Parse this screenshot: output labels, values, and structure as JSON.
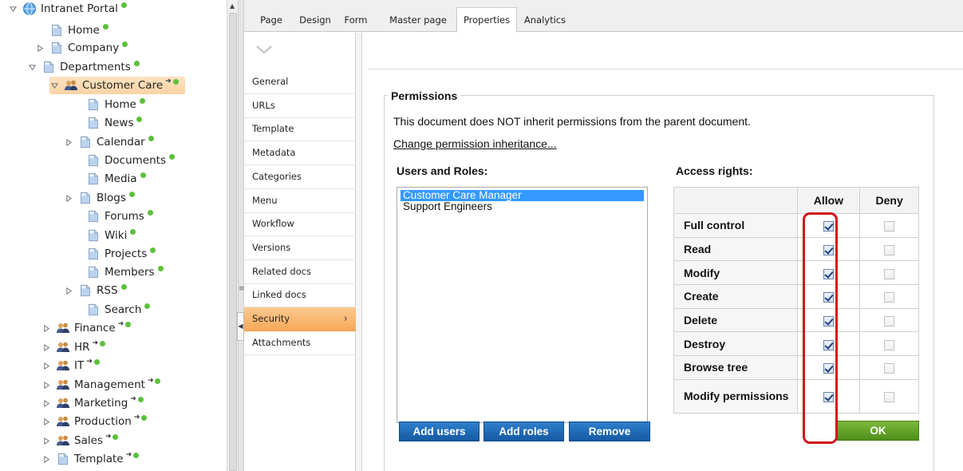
{
  "tree": {
    "items": [
      {
        "label": "Intranet Portal",
        "icon": "globe-icon",
        "expander": "down",
        "dot": true,
        "arrow": false
      },
      {
        "label": "Home",
        "icon": "page-icon",
        "expander": "none",
        "dot": true,
        "arrow": false
      },
      {
        "label": "Company",
        "icon": "page-icon",
        "expander": "right",
        "dot": true,
        "arrow": false
      },
      {
        "label": "Departments",
        "icon": "page-icon",
        "expander": "down",
        "dot": true,
        "arrow": false
      },
      {
        "label": "Customer Care",
        "icon": "users-icon",
        "expander": "down",
        "dot": true,
        "arrow": true,
        "selected": true
      },
      {
        "label": "Home",
        "icon": "page-icon",
        "expander": "none",
        "dot": true,
        "arrow": false
      },
      {
        "label": "News",
        "icon": "page-icon",
        "expander": "none",
        "dot": true,
        "arrow": false
      },
      {
        "label": "Calendar",
        "icon": "page-icon",
        "expander": "right",
        "dot": true,
        "arrow": false
      },
      {
        "label": "Documents",
        "icon": "page-icon",
        "expander": "none",
        "dot": true,
        "arrow": false
      },
      {
        "label": "Media",
        "icon": "page-icon",
        "expander": "none",
        "dot": true,
        "arrow": false
      },
      {
        "label": "Blogs",
        "icon": "page-icon",
        "expander": "right",
        "dot": true,
        "arrow": false
      },
      {
        "label": "Forums",
        "icon": "page-icon",
        "expander": "none",
        "dot": true,
        "arrow": false
      },
      {
        "label": "Wiki",
        "icon": "page-icon",
        "expander": "none",
        "dot": true,
        "arrow": false
      },
      {
        "label": "Projects",
        "icon": "page-icon",
        "expander": "none",
        "dot": true,
        "arrow": false
      },
      {
        "label": "Members",
        "icon": "page-icon",
        "expander": "none",
        "dot": true,
        "arrow": false
      },
      {
        "label": "RSS",
        "icon": "page-icon",
        "expander": "right",
        "dot": true,
        "arrow": false
      },
      {
        "label": "Search",
        "icon": "page-icon",
        "expander": "none",
        "dot": true,
        "arrow": false
      },
      {
        "label": "Finance",
        "icon": "users-icon",
        "expander": "right",
        "dot": true,
        "arrow": true
      },
      {
        "label": "HR",
        "icon": "users-icon",
        "expander": "right",
        "dot": true,
        "arrow": true
      },
      {
        "label": "IT",
        "icon": "users-icon",
        "expander": "right",
        "dot": true,
        "arrow": true
      },
      {
        "label": "Management",
        "icon": "users-icon",
        "expander": "right",
        "dot": true,
        "arrow": true
      },
      {
        "label": "Marketing",
        "icon": "users-icon",
        "expander": "right",
        "dot": true,
        "arrow": true
      },
      {
        "label": "Production",
        "icon": "users-icon",
        "expander": "right",
        "dot": true,
        "arrow": true
      },
      {
        "label": "Sales",
        "icon": "users-icon",
        "expander": "right",
        "dot": true,
        "arrow": true
      },
      {
        "label": "Template",
        "icon": "page-icon",
        "expander": "right",
        "dot": true,
        "arrow": true
      }
    ]
  },
  "tabs": [
    "Page",
    "Design",
    "Form",
    "Master page",
    "Properties",
    "Analytics"
  ],
  "active_tab": "Properties",
  "vmenu": {
    "items": [
      "General",
      "URLs",
      "Template",
      "Metadata",
      "Categories",
      "Menu",
      "Workflow",
      "Versions",
      "Related docs",
      "Linked docs",
      "Security",
      "Attachments"
    ],
    "active": "Security"
  },
  "permissions": {
    "legend": "Permissions",
    "inherit_text": "This document does NOT inherit permissions from the parent document.",
    "change_link": "Change permission inheritance...",
    "users_roles_label": "Users and Roles:",
    "access_rights_label": "Access rights:",
    "roles": [
      {
        "name": "Customer Care Manager",
        "selected": true
      },
      {
        "name": "Support Engineers",
        "selected": false
      }
    ],
    "buttons": {
      "add_users": "Add users",
      "add_roles": "Add roles",
      "remove": "Remove",
      "ok": "OK"
    },
    "columns": {
      "allow": "Allow",
      "deny": "Deny"
    },
    "rights": [
      {
        "name": "Full control",
        "allow": true,
        "deny": false
      },
      {
        "name": "Read",
        "allow": true,
        "deny": false
      },
      {
        "name": "Modify",
        "allow": true,
        "deny": false
      },
      {
        "name": "Create",
        "allow": true,
        "deny": false
      },
      {
        "name": "Delete",
        "allow": true,
        "deny": false
      },
      {
        "name": "Destroy",
        "allow": true,
        "deny": false
      },
      {
        "name": "Browse tree",
        "allow": true,
        "deny": false
      },
      {
        "name": "Modify permissions",
        "allow": true,
        "deny": false
      }
    ]
  },
  "colors": {
    "selection_orange": "#fbd3a6",
    "status_dot_green": "#5dc03b",
    "button_blue": "#1e6bb8",
    "button_green": "#5a9e23",
    "highlight_red": "#d0151c",
    "list_selection": "#3399ff"
  }
}
